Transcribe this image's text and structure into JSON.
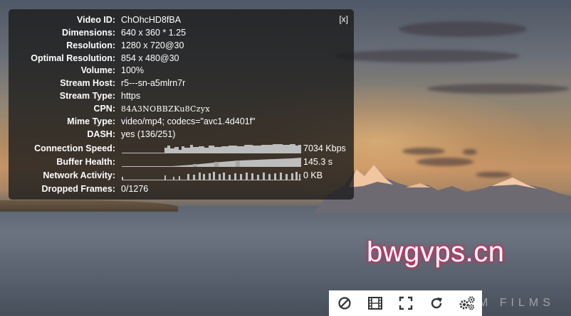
{
  "stats": {
    "close_label": "[x]",
    "rows": [
      {
        "label": "Video ID:",
        "value": "ChOhcHD8fBA"
      },
      {
        "label": "Dimensions:",
        "value": "640 x 360 * 1.25"
      },
      {
        "label": "Resolution:",
        "value": "1280 x 720@30"
      },
      {
        "label": "Optimal Resolution:",
        "value": "854 x 480@30"
      },
      {
        "label": "Volume:",
        "value": "100%"
      },
      {
        "label": "Stream Host:",
        "value": "r5---sn-a5mlrn7r"
      },
      {
        "label": "Stream Type:",
        "value": "https"
      },
      {
        "label": "CPN:",
        "value": "84A3NOBBZKu8Czyx"
      },
      {
        "label": "Mime Type:",
        "value": "video/mp4; codecs=\"avc1.4d401f\""
      },
      {
        "label": "DASH:",
        "value": "yes (136/251)"
      }
    ],
    "graphs": [
      {
        "label": "Connection Speed:",
        "value": "7034 Kbps"
      },
      {
        "label": "Buffer Health:",
        "value": "145.3 s"
      },
      {
        "label": "Network Activity:",
        "value": "0 KB"
      }
    ],
    "dropped": {
      "label": "Dropped Frames:",
      "value": "0/1276"
    }
  },
  "watermark": {
    "text": "bwgvps.cn"
  },
  "background_text": {
    "films": "M FILMS"
  },
  "controls": [
    {
      "name": "block-button",
      "icon": "block-icon"
    },
    {
      "name": "film-button",
      "icon": "film-icon"
    },
    {
      "name": "fullscreen-button",
      "icon": "fullscreen-icon"
    },
    {
      "name": "refresh-button",
      "icon": "refresh-icon"
    },
    {
      "name": "settings-button",
      "icon": "gears-icon"
    }
  ],
  "colors": {
    "overlay_bg": "#1c1c1c",
    "graph": "#bdbdbd",
    "watermark_glow": "#e0245e"
  }
}
